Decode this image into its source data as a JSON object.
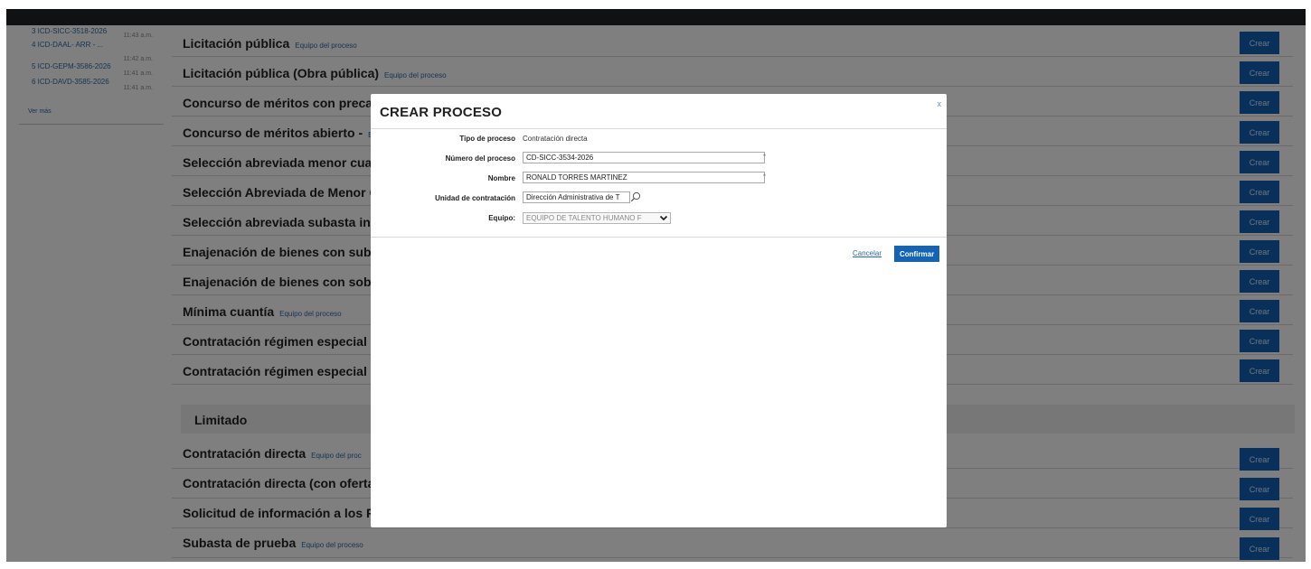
{
  "sidebar": {
    "recent": [
      {
        "code": "3 ICD-SICC-3518-2026",
        "time": "11:43 a.m."
      },
      {
        "code": "4 ICD-DAAL- ARR - ...",
        "time": "11:42 a.m."
      },
      {
        "code": "5 ICD-GEPM-3586-2026",
        "time": "11:41 a.m."
      },
      {
        "code": "6 ICD-DAVD-3585-2026",
        "time": "11:41 a.m."
      }
    ],
    "see_more": "Ver más"
  },
  "processes": [
    {
      "title": "Licitación pública",
      "link": "Equipo del proceso"
    },
    {
      "title": "Licitación pública (Obra pública)",
      "link": "Equipo del proceso"
    },
    {
      "title": "Concurso de méritos con precal",
      "link": ""
    },
    {
      "title": "Concurso de méritos abierto -",
      "link": "E"
    },
    {
      "title": "Selección abreviada menor cuar",
      "link": ""
    },
    {
      "title": "Selección Abreviada de Menor C",
      "link": ""
    },
    {
      "title": "Selección abreviada subasta inv",
      "link": ""
    },
    {
      "title": "Enajenación de bienes con suba",
      "link": ""
    },
    {
      "title": "Enajenación de bienes con sobr",
      "link": ""
    },
    {
      "title": "Mínima cuantía",
      "link": "Equipo del proceso"
    },
    {
      "title": "Contratación régimen especial",
      "link": ""
    },
    {
      "title": "Contratación régimen especial (",
      "link": ""
    }
  ],
  "limited_section": {
    "title": "Limitado",
    "processes": [
      {
        "title": "Contratación directa",
        "link": "Equipo del proc"
      },
      {
        "title": "Contratación directa (con oferta",
        "link": ""
      },
      {
        "title": "Solicitud de información a los P",
        "link": ""
      },
      {
        "title": "Subasta de prueba",
        "link": "Equipo del proceso"
      }
    ]
  },
  "create_button_label": "Crear",
  "modal": {
    "title": "CREAR PROCESO",
    "close": "x",
    "fields": {
      "tipo_label": "Tipo de proceso",
      "tipo_value": "Contratación directa",
      "numero_label": "Número del proceso",
      "numero_value": "CD-SICC-3534-2026",
      "nombre_label": "Nombre",
      "nombre_value": "RONALD TORRES MARTINEZ",
      "unidad_label": "Unidad de contratación",
      "unidad_value": "Dirección Administrativa de T",
      "equipo_label": "Equipo:",
      "equipo_value": "EQUIPO DE TALENTO HUMANO F",
      "required_mark": "*"
    },
    "cancel_label": "Cancelar",
    "confirm_label": "Confirmar"
  },
  "colors": {
    "topbar": "#1f2226",
    "button_blue": "#1161b7",
    "link_blue": "#2b6aa6",
    "overlay": "rgba(0,0,0,0.5)"
  },
  "icons": [
    "search-icon",
    "chevron-down-icon",
    "close-icon"
  ]
}
